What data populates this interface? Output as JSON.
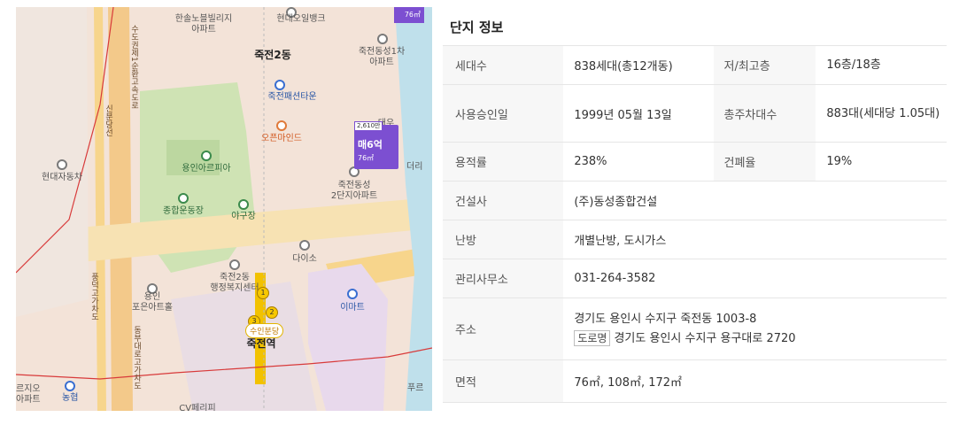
{
  "map": {
    "labels": [
      {
        "text": "한솔노블빌리지\n아파트"
      },
      {
        "text": "현대오일뱅크"
      },
      {
        "text": "죽전2동"
      },
      {
        "text": "죽전동성1차\n아파트"
      },
      {
        "text": "죽전패션타운"
      },
      {
        "text": "대우\n아빌"
      },
      {
        "text": "오픈마인드"
      },
      {
        "text": "용인아르피아"
      },
      {
        "text": "현대자동차"
      },
      {
        "text": "죽전동성\n2단지아파트"
      },
      {
        "text": "더리"
      },
      {
        "text": "종합운동장"
      },
      {
        "text": "야구장"
      },
      {
        "text": "다이소"
      },
      {
        "text": "죽전2동\n행정복지센터"
      },
      {
        "text": "용인\n포은아트홀"
      },
      {
        "text": "이마트"
      },
      {
        "text": "죽전역"
      },
      {
        "text": "르지오\n아파트"
      },
      {
        "text": "농협"
      },
      {
        "text": "푸르"
      },
      {
        "text": "CV페리피"
      }
    ],
    "road_labels": [
      "수도권제1순환고속도로",
      "신분당선",
      "풍덕고가차도",
      "동부대로고가차도"
    ],
    "price_tag": {
      "top": "2,610만",
      "main": "매6억",
      "area": "76㎡"
    },
    "corner_tag": "76㎡",
    "station_badge": "수인분당",
    "station_numbers": [
      "1",
      "2",
      "3"
    ]
  },
  "info": {
    "title": "단지 정보",
    "rows": {
      "households": {
        "label": "세대수",
        "value": "838세대(총12개동)",
        "label2": "저/최고층",
        "value2": "16층/18층"
      },
      "approval": {
        "label": "사용승인일",
        "value": "1999년 05월 13일",
        "label2": "총주차대수",
        "value2": "883대(세대당 1.05대)"
      },
      "far": {
        "label": "용적률",
        "value": "238%",
        "label2": "건폐율",
        "value2": "19%"
      },
      "builder": {
        "label": "건설사",
        "value": "(주)동성종합건설"
      },
      "heating": {
        "label": "난방",
        "value": "개별난방, 도시가스"
      },
      "office": {
        "label": "관리사무소",
        "value": "031-264-3582"
      },
      "address": {
        "label": "주소",
        "lot": "경기도 용인시 수지구 죽전동 1003-8",
        "road_tag": "도로명",
        "road": "경기도 용인시 수지구 용구대로 2720"
      },
      "area": {
        "label": "면적",
        "value": "76㎡, 108㎡, 172㎡"
      }
    }
  },
  "colors": {
    "map_bg": "#f3e3d8",
    "park": "#cfe3b4",
    "road": "#f7d58c",
    "accent_purple": "#7c4fd1",
    "red_line": "#d83a3a"
  }
}
